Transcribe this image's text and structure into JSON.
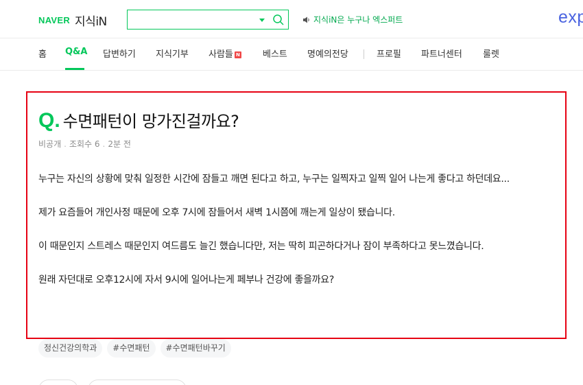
{
  "header": {
    "logo_naver": "NAVER",
    "logo_service": "지식iN",
    "search_value": "",
    "notice": "지식iN은 누구나 엑스퍼트",
    "expert_cut": "exp",
    "brand_color": "#03c75a"
  },
  "nav": {
    "items": [
      "홈",
      "Q&A",
      "답변하기",
      "지식기부",
      "사람들",
      "베스트",
      "명예의전당",
      "프로필",
      "파트너센터",
      "룰렛"
    ],
    "active": "Q&A",
    "new_badge": "N"
  },
  "question": {
    "mark": "Q.",
    "title": "수면패턴이 망가진걸까요?",
    "author": "비공개",
    "views": "조회수 6",
    "time": "2분 전",
    "paragraphs": [
      "누구는 자신의 상황에 맞춰 일정한 시간에 잠들고 깨면 된다고 하고, 누구는 일찍자고 일찍 일어 나는게 좋다고 하던데요...",
      "제가 요즘들어 개인사정 때문에 오후 7시에 잠들어서 새벽 1시쯤에 깨는게 일상이 됐습니다.",
      "이 때문인지 스트레스 때문인지 여드름도 늘긴 했습니다만, 저는 딱히 피곤하다거나 잠이 부족하다고 못느꼈습니다.",
      "원래 자던대로 오후12시에 자서 9시에 일어나는게 페부나 건강에 좋을까요?"
    ],
    "highlight_color": "#e60012"
  },
  "tags": [
    "정신건강의학과",
    "#수면패턴",
    "#수면패턴바꾸기"
  ]
}
